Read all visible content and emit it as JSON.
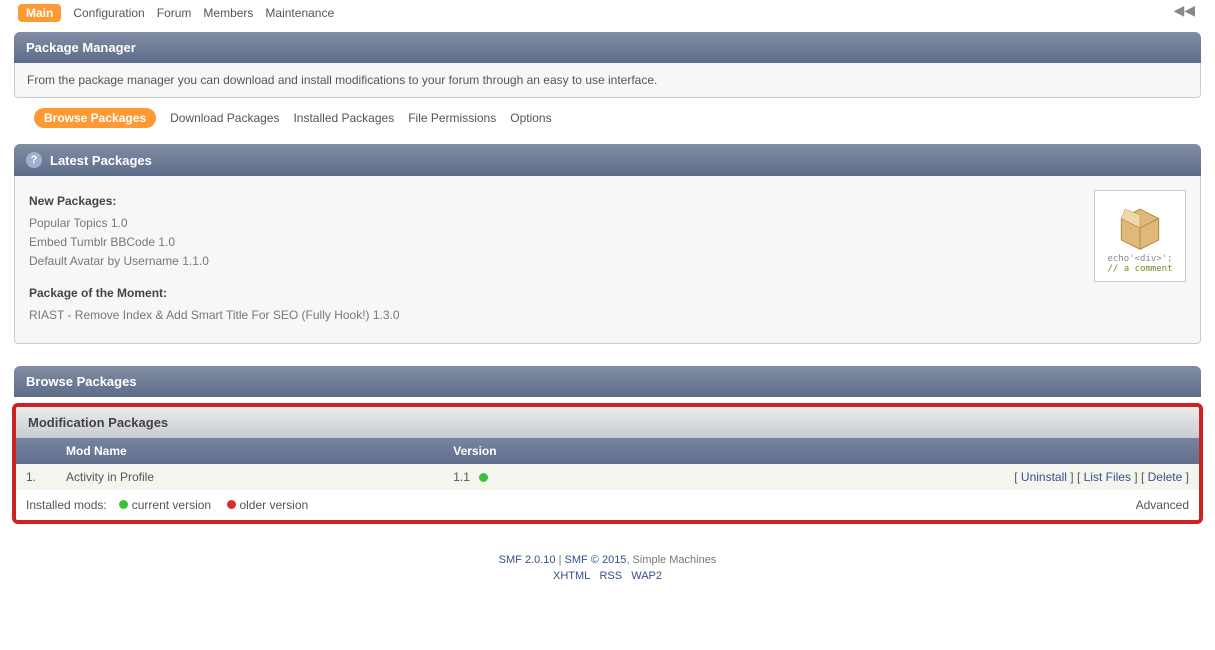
{
  "topnav": {
    "items": [
      {
        "label": "Main",
        "active": true
      },
      {
        "label": "Configuration",
        "active": false
      },
      {
        "label": "Forum",
        "active": false
      },
      {
        "label": "Members",
        "active": false
      },
      {
        "label": "Maintenance",
        "active": false
      }
    ]
  },
  "package_manager": {
    "title": "Package Manager",
    "description": "From the package manager you can download and install modifications to your forum through an easy to use interface."
  },
  "subnav": {
    "items": [
      {
        "label": "Browse Packages",
        "active": true
      },
      {
        "label": "Download Packages",
        "active": false
      },
      {
        "label": "Installed Packages",
        "active": false
      },
      {
        "label": "File Permissions",
        "active": false
      },
      {
        "label": "Options",
        "active": false
      }
    ]
  },
  "latest": {
    "title": "Latest Packages",
    "new_heading": "New Packages:",
    "new_items": [
      "Popular Topics 1.0",
      "Embed Tumblr BBCode 1.0",
      "Default Avatar by Username 1.1.0"
    ],
    "moment_heading": "Package of the Moment:",
    "moment_item": "RIAST - Remove Index & Add Smart Title For SEO (Fully Hook!) 1.3.0",
    "box_echo": "echo'<div>';",
    "box_comment": "// a comment"
  },
  "browse": {
    "title": "Browse Packages"
  },
  "mod_section": {
    "title": "Modification Packages",
    "columns": {
      "name": "Mod Name",
      "version": "Version"
    },
    "rows": [
      {
        "idx": "1.",
        "name": "Activity in Profile",
        "version": "1.1",
        "status": "green",
        "actions": {
          "uninstall": "Uninstall",
          "list": "List Files",
          "delete": "Delete"
        }
      }
    ],
    "legend": {
      "prefix": "Installed mods:",
      "current": "current version",
      "older": "older version",
      "advanced": "Advanced"
    }
  },
  "footer": {
    "line1_a": "SMF 2.0.10",
    "line1_sep": " | ",
    "line1_b": "SMF © 2015",
    "line1_c": ", Simple Machines",
    "line2": {
      "xhtml": "XHTML",
      "rss": "RSS",
      "wap2": "WAP2"
    }
  }
}
